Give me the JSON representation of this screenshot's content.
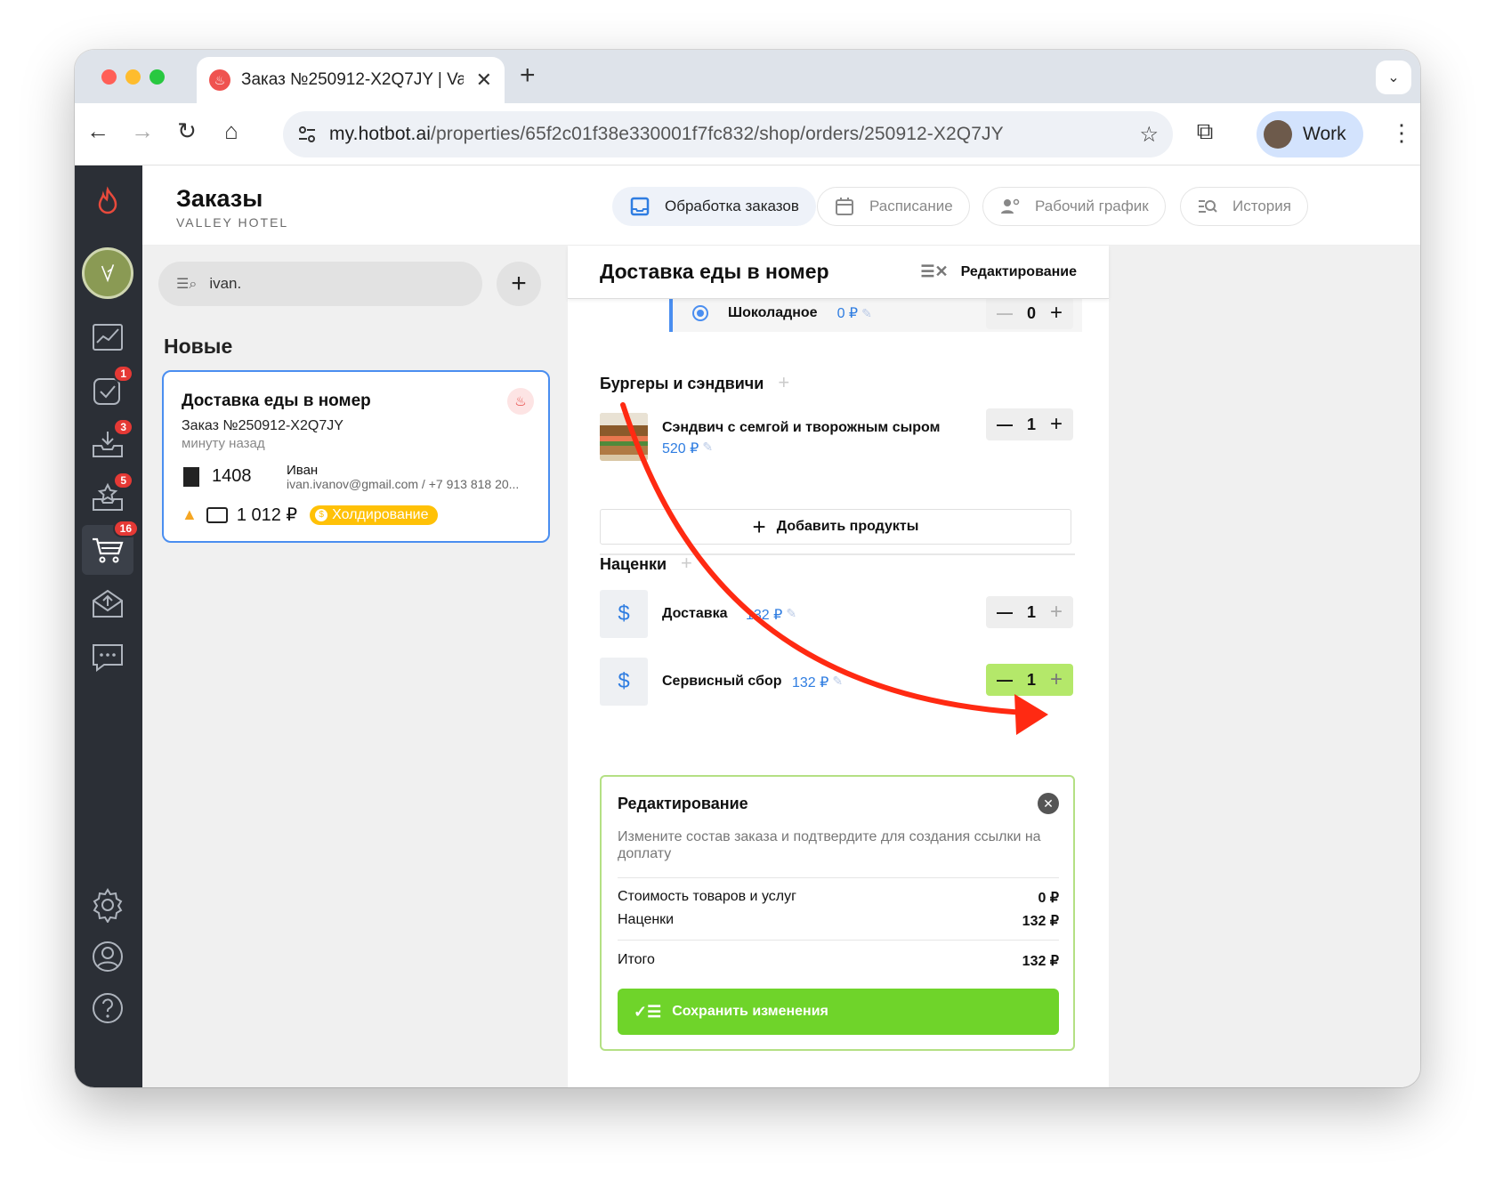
{
  "browser": {
    "tab_title": "Заказ №250912-X2Q7JY | Va",
    "url_host": "my.hotbot.ai",
    "url_path": "/properties/65f2c01f38e330001f7fc832/shop/orders/250912-X2Q7JY",
    "profile_label": "Work"
  },
  "sidebar": {
    "badges": {
      "tasks": "1",
      "inbox": "3",
      "reviews": "5",
      "shop": "16"
    }
  },
  "header": {
    "title": "Заказы",
    "subtitle": "VALLEY HOTEL",
    "tabs": [
      "Обработка заказов",
      "Расписание",
      "Рабочий график",
      "История"
    ]
  },
  "left": {
    "search_value": "ivan.",
    "section_title": "Новые",
    "card": {
      "title": "Доставка еды в номер",
      "order": "Заказ №250912-X2Q7JY",
      "time": "минуту назад",
      "room": "1408",
      "guest_name": "Иван",
      "guest_contact": "ivan.ivanov@gmail.com / +7 913 818 20...",
      "amount": "1 012 ₽",
      "status": "Холдирование"
    }
  },
  "order": {
    "title": "Доставка еды в номер",
    "edit_label": "Редактирование",
    "chocolate": {
      "name": "Шоколадное",
      "price": "0 ₽",
      "qty": "0"
    },
    "burgers_section": "Бургеры и сэндвичи",
    "sandwich": {
      "name": "Сэндвич с семгой и творожным сыром",
      "price": "520 ₽",
      "qty": "1"
    },
    "add_products": "Добавить продукты",
    "markups_section": "Наценки",
    "delivery": {
      "name": "Доставка",
      "price": "132 ₽",
      "qty": "1"
    },
    "service": {
      "name": "Сервисный сбор",
      "price": "132 ₽",
      "qty": "1"
    }
  },
  "edit_panel": {
    "title": "Редактирование",
    "description": "Измените состав заказа и подтвердите для создания ссылки на доплату",
    "goods_label": "Стоимость товаров и услуг",
    "goods_value": "0 ₽",
    "markups_label": "Наценки",
    "markups_value": "132 ₽",
    "total_label": "Итого",
    "total_value": "132 ₽",
    "save_label": "Сохранить изменения"
  },
  "colors": {
    "accent_blue": "#2f7de1",
    "highlight_green": "#b4e86a",
    "save_green": "#6fd42a",
    "arrow_red": "#ff2a12",
    "sidebar": "#2b2f36"
  }
}
